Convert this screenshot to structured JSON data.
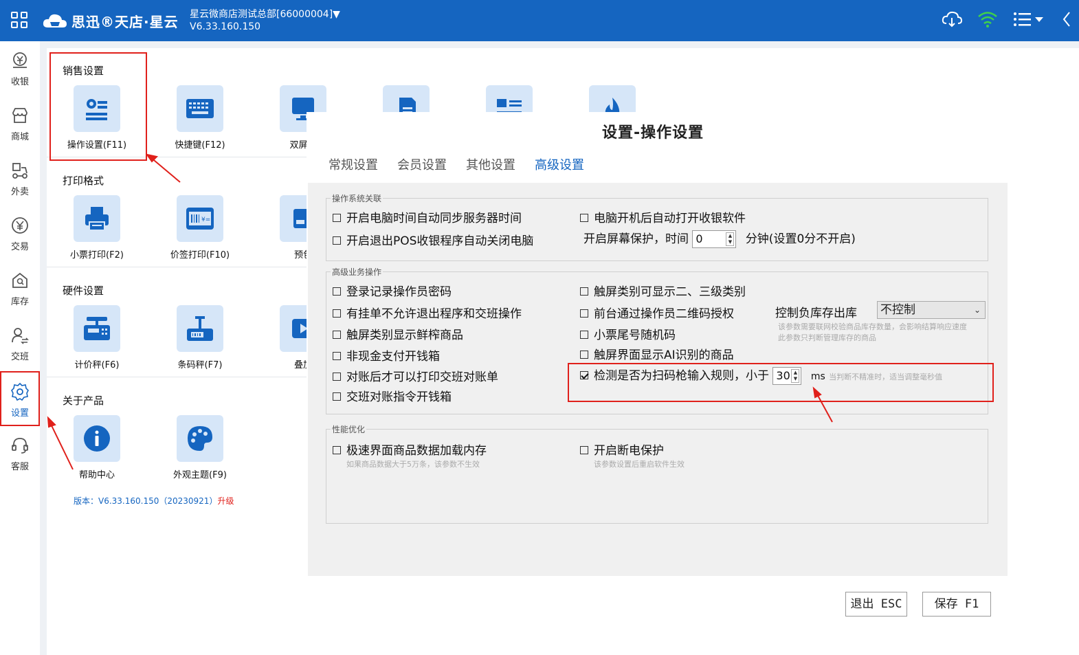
{
  "header": {
    "brand": "思迅®天店·星云",
    "store": "星云微商店测试总部[66000004]▼",
    "version": "V6.33.160.150"
  },
  "sidebar": {
    "items": [
      {
        "label": "收银",
        "icon": "cashier-icon"
      },
      {
        "label": "商城",
        "icon": "store-icon"
      },
      {
        "label": "外卖",
        "icon": "delivery-icon"
      },
      {
        "label": "交易",
        "icon": "yen-icon"
      },
      {
        "label": "库存",
        "icon": "warehouse-icon"
      },
      {
        "label": "交班",
        "icon": "user-shift-icon"
      },
      {
        "label": "设置",
        "icon": "gear-icon"
      },
      {
        "label": "客服",
        "icon": "headset-icon"
      }
    ]
  },
  "panel": {
    "sections": {
      "sales": "销售设置",
      "print": "打印格式",
      "hardware": "硬件设置",
      "about": "关于产品"
    },
    "tiles": {
      "op_settings": "操作设置(F11)",
      "shortcuts": "快捷键(F12)",
      "dual_screen": "双屏设",
      "receipt_print": "小票打印(F2)",
      "label_print": "价签打印(F10)",
      "preorder": "预包",
      "price_scale": "计价秤(F6)",
      "barcode_scale": "条码秤(F7)",
      "overlay": "叠加",
      "help": "帮助中心",
      "theme": "外观主题(F9)"
    },
    "version_text": "版本：V6.33.160.150（20230921）",
    "upgrade": "升级"
  },
  "dialog": {
    "title": "设置-操作设置",
    "tabs": [
      "常规设置",
      "会员设置",
      "其他设置",
      "高级设置"
    ],
    "groups": {
      "os": "操作系统关联",
      "advanced": "高级业务操作",
      "perf": "性能优化"
    },
    "os": {
      "sync_time": "开启电脑时间自动同步服务器时间",
      "autostart": "电脑开机后自动打开收银软件",
      "shutdown": "开启退出POS收银程序自动关闭电脑",
      "screensaver_prefix": "开启屏幕保护，时间",
      "screensaver_value": "0",
      "screensaver_suffix": "分钟(设置0分不开启)"
    },
    "advanced": {
      "login_pwd": "登录记录操作员密码",
      "touch_category": "触屏类别可显示二、三级类别",
      "hang_order": "有挂单不允许退出程序和交班操作",
      "qr_auth": "前台通过操作员二维码授权",
      "neg_stock_label": "控制负库存出库",
      "neg_stock_value": "不控制",
      "neg_stock_hint1": "该参数需要联网校验商品库存数量，会影响结算响应速度",
      "neg_stock_hint2": "此参数只判断管理库存的商品",
      "fresh": "触屏类别显示鲜榨商品",
      "receipt_rand": "小票尾号随机码",
      "non_cash_drawer": "非现金支付开钱箱",
      "ai_goods": "触屏界面显示AI识别的商品",
      "print_after_check": "对账后才可以打印交班对账单",
      "scanner_prefix": "检测是否为扫码枪输入规则，小于",
      "scanner_value": "30",
      "scanner_unit": "ms",
      "scanner_hint": "当判断不精准时，适当调整毫秒值",
      "shift_drawer": "交班对账指令开钱箱"
    },
    "perf": {
      "fast_load": "极速界面商品数据加载内存",
      "fast_load_hint": "如果商品数据大于5万条，该参数不生效",
      "power_protect": "开启断电保护",
      "power_hint": "该参数设置后重启软件生效"
    },
    "buttons": {
      "exit": "退出 ESC",
      "save": "保存 F1"
    }
  },
  "colors": {
    "brand_blue": "#1565c0",
    "highlight_red": "#e0201b",
    "tile_bg": "#d6e6f8"
  }
}
